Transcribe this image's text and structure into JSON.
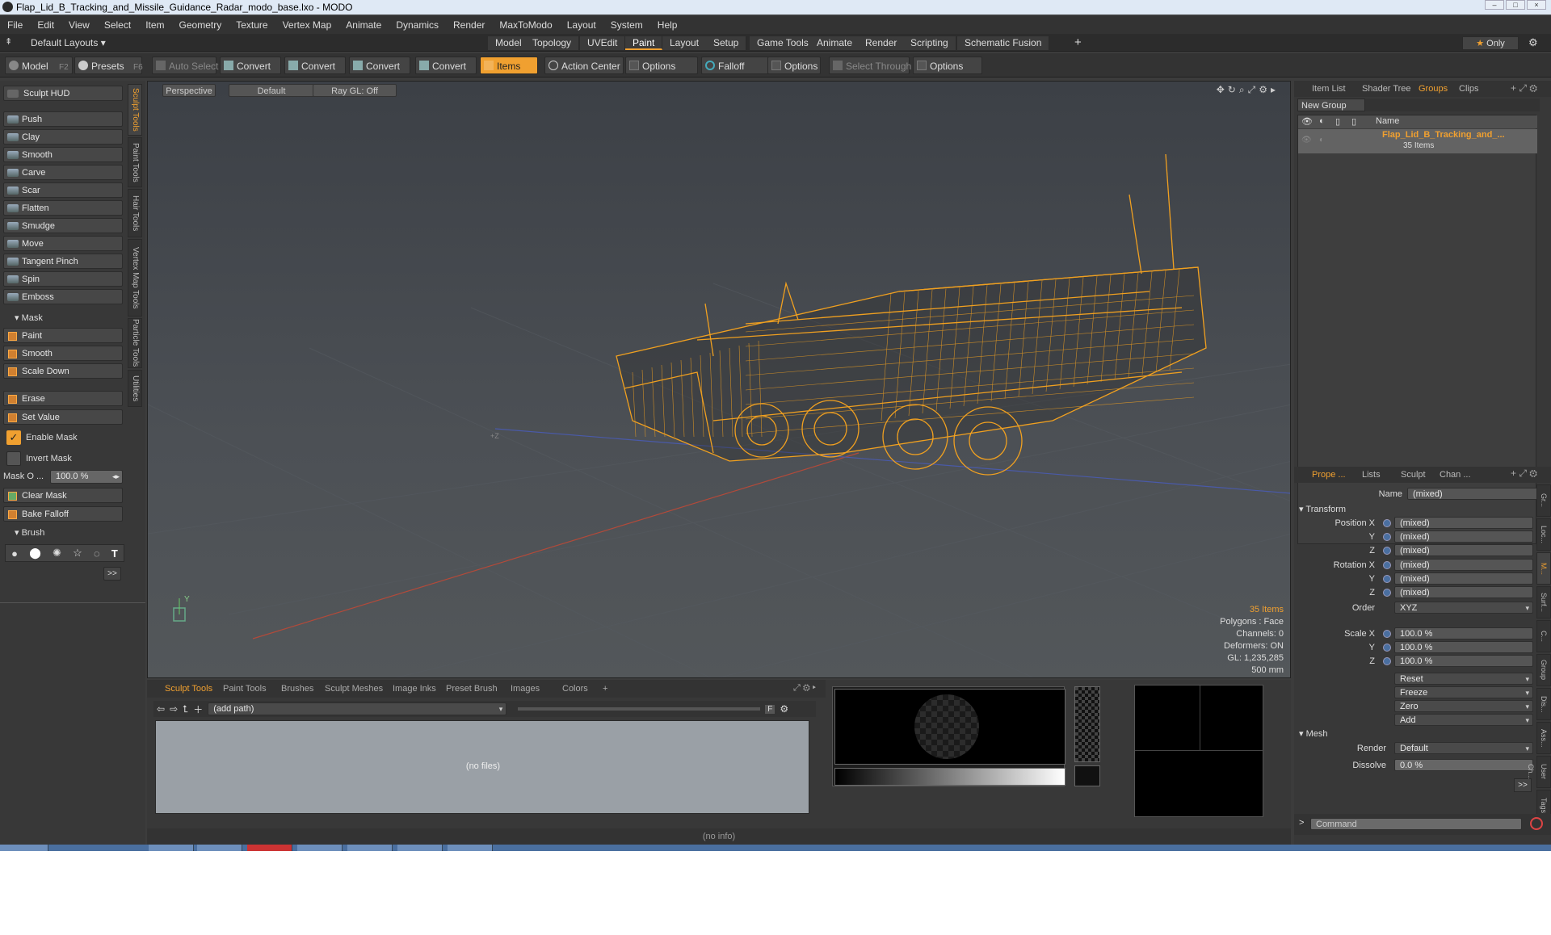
{
  "window": {
    "title": "Flap_Lid_B_Tracking_and_Missile_Guidance_Radar_modo_base.lxo - MODO"
  },
  "menu": [
    "File",
    "Edit",
    "View",
    "Select",
    "Item",
    "Geometry",
    "Texture",
    "Vertex Map",
    "Animate",
    "Dynamics",
    "Render",
    "MaxToModo",
    "Layout",
    "System",
    "Help"
  ],
  "layout": {
    "label": "Default Layouts",
    "tabs": [
      "Model",
      "Topology",
      "UVEdit",
      "Paint",
      "Layout",
      "Setup",
      "Game Tools",
      "Animate",
      "Render",
      "Scripting",
      "Schematic Fusion"
    ],
    "active_tab": "Paint",
    "only": "Only"
  },
  "toolbar": {
    "model": "Model",
    "model_key": "F2",
    "presets": "Presets",
    "presets_key": "F6",
    "auto_select": "Auto Select",
    "convert": "Convert",
    "items": "Items",
    "action_center": "Action Center",
    "options": "Options",
    "falloff": "Falloff",
    "select_through": "Select Through"
  },
  "left": {
    "hud": "Sculpt HUD",
    "tools": [
      "Push",
      "Clay",
      "Smooth",
      "Carve",
      "Scar",
      "Flatten",
      "Smudge",
      "Move",
      "Tangent Pinch",
      "Spin",
      "Emboss"
    ],
    "mask_section": "Mask",
    "mask_tools": [
      "Paint",
      "Smooth",
      "Scale Down"
    ],
    "erase": "Erase",
    "set_value": "Set Value",
    "enable_mask": "Enable Mask",
    "invert_mask": "Invert Mask",
    "mask_opacity_label": "Mask O ...",
    "mask_opacity_value": "100.0 %",
    "clear_mask": "Clear Mask",
    "bake_falloff": "Bake Falloff",
    "brush_section": "Brush",
    "more": ">>",
    "vtabs": [
      "Sculpt Tools",
      "Paint Tools",
      "Hair Tools",
      "Vertex Map Tools",
      "Particle Tools",
      "Utilities"
    ]
  },
  "viewport": {
    "tabs": [
      "Perspective",
      "Default",
      "Ray GL: Off"
    ],
    "info": [
      "35 Items",
      "Polygons : Face",
      "Channels: 0",
      "Deformers: ON",
      "GL: 1,235,285",
      "500 mm"
    ],
    "axis_y": "Y",
    "axis_z": "+Z"
  },
  "bottom": {
    "tabs": [
      "Sculpt Tools",
      "Paint Tools",
      "Brushes",
      "Sculpt Meshes",
      "Image Inks",
      "Preset Brush",
      "Images",
      "Colors",
      "+"
    ],
    "path": "(add path)",
    "no_files": "(no files)",
    "status": "(no info)"
  },
  "right": {
    "tabs": [
      "Item List",
      "Shader Tree",
      "Groups",
      "Clips"
    ],
    "new_group": "New Group",
    "col_name": "Name",
    "group_name": "Flap_Lid_B_Tracking_and_...",
    "group_count": "35 Items",
    "prop_tabs": [
      "Prope ...",
      "Lists",
      "Sculpt",
      "Chan ..."
    ],
    "name_label": "Name",
    "name_value": "(mixed)",
    "transform": "Transform",
    "position_x": "Position X",
    "rotation_x": "Rotation X",
    "scale_x": "Scale X",
    "y": "Y",
    "z": "Z",
    "mixed": "(mixed)",
    "order_label": "Order",
    "order_value": "XYZ",
    "scale_value": "100.0 %",
    "reset": "Reset",
    "freeze": "Freeze",
    "zero": "Zero",
    "add": "Add",
    "mesh": "Mesh",
    "render_label": "Render",
    "render_value": "Default",
    "dissolve_label": "Dissolve",
    "dissolve_value": "0.0 %",
    "more": ">>",
    "command": "Command",
    "vtabs": [
      "Gr...",
      "Loc...",
      "M...",
      "Surf...",
      "C...",
      "Group",
      "Dis...",
      "Ass...",
      "User Ch...",
      "Tags"
    ]
  },
  "colors": {
    "accent": "#f0a030",
    "wire": "#f0a020",
    "panel": "#383838",
    "viewport": "#4a4e53"
  }
}
